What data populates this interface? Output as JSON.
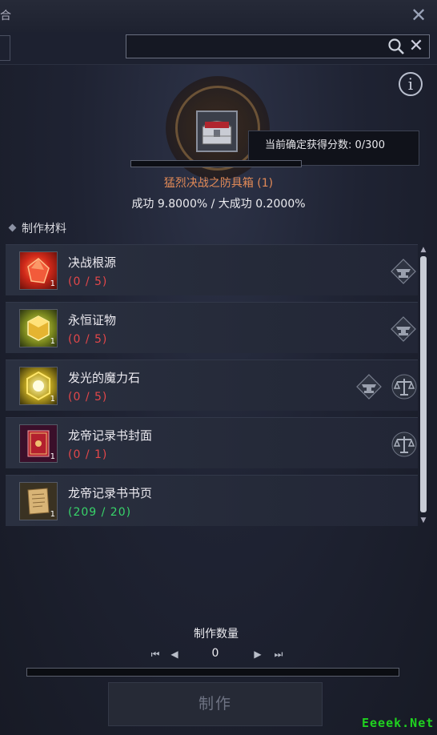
{
  "window": {
    "title_fragment": "合",
    "close_label": "✕"
  },
  "search": {
    "value": "",
    "placeholder": "",
    "clear_label": "✕"
  },
  "info_label": "i",
  "target": {
    "score_tip": "当前确定获得分数: 0/300",
    "name": "猛烈决战之防具箱 (1)",
    "rates": "成功 9.8000% / 大成功 0.2000%"
  },
  "materials_section_title": "制作材料",
  "materials": [
    {
      "name": "决战根源",
      "count": "(0 / 5)",
      "status": "red",
      "qty": "1",
      "icon": "red-gem-icon",
      "actions": [
        "anvil-icon"
      ]
    },
    {
      "name": "永恒证物",
      "count": "(0 / 5)",
      "status": "red",
      "qty": "1",
      "icon": "gold-cube-icon",
      "actions": [
        "anvil-icon"
      ]
    },
    {
      "name": "发光的魔力石",
      "count": "(0 / 5)",
      "status": "red",
      "qty": "1",
      "icon": "glowing-stone-icon",
      "actions": [
        "anvil-icon",
        "scale-icon"
      ]
    },
    {
      "name": "龙帝记录书封面",
      "count": "(0 / 1)",
      "status": "red",
      "qty": "1",
      "icon": "book-cover-icon",
      "actions": [
        "scale-icon"
      ]
    },
    {
      "name": "龙帝记录书书页",
      "count": "(209 / 20)",
      "status": "green",
      "qty": "1",
      "icon": "book-page-icon",
      "actions": []
    }
  ],
  "craft": {
    "quantity_label": "制作数量",
    "quantity_value": "0",
    "button_label": "制作"
  },
  "watermark": "Eeeek.Net",
  "colors": {
    "item_name": "#e28a57",
    "count_insufficient": "#e4474a",
    "count_sufficient": "#38d46a"
  }
}
